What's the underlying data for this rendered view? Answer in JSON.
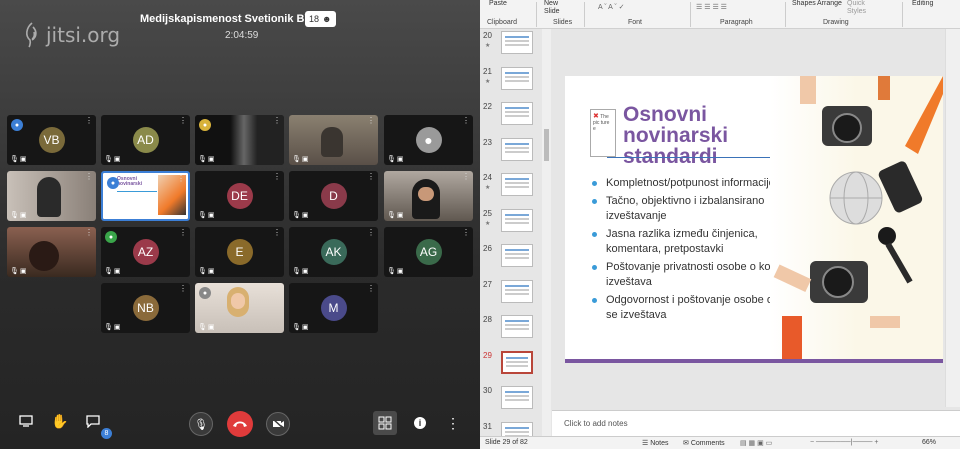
{
  "jitsi": {
    "logo_text": "jitsi.org",
    "meeting_title": "Medijskapismenost Svetionik BYS",
    "participant_count": "18",
    "timer": "2:04:59",
    "tiles": [
      {
        "initials": "VB",
        "color": "#7a6a3a",
        "status": "#3c7fd6"
      },
      {
        "initials": "AD",
        "color": "#8a8a4a"
      },
      {
        "initials": "",
        "color": "",
        "status": "#d8b23a",
        "video": "dark-room"
      },
      {
        "initials": "",
        "color": "",
        "video": "room"
      },
      {
        "initials": "",
        "color": "#7a7a7a",
        "video": "default-avatar"
      },
      {
        "initials": "",
        "color": "",
        "video": "person"
      },
      {
        "initials": "",
        "color": "",
        "status": "#3c7fd6",
        "video": "shared-slide"
      },
      {
        "initials": "DE",
        "color": "#9b3a4a"
      },
      {
        "initials": "D",
        "color": "#8a3a4a"
      },
      {
        "initials": "",
        "color": "",
        "video": "person-glasses"
      },
      {
        "initials": "",
        "color": "",
        "video": "person-lowlight"
      },
      {
        "initials": "AZ",
        "color": "#9b3a4a",
        "status": "#3aa54a"
      },
      {
        "initials": "E",
        "color": "#8a6a2a"
      },
      {
        "initials": "AK",
        "color": "#3a6a5a"
      },
      {
        "initials": "AG",
        "color": "#3a6a4a"
      },
      {
        "initials": "NB",
        "color": "#8a6a3a"
      },
      {
        "initials": "",
        "color": "",
        "status": "#888888",
        "video": "person-blonde"
      },
      {
        "initials": "M",
        "color": "#4a4a8a"
      }
    ],
    "chat_unread": "8"
  },
  "ppt": {
    "ribbon": {
      "paste": "Paste",
      "new_slide": "New\nSlide",
      "clipboard": "Clipboard",
      "slides": "Slides",
      "font": "Font",
      "paragraph": "Paragraph",
      "shapes": "Shapes",
      "arrange": "Arrange",
      "quick_styles": "Quick\nStyles",
      "drawing": "Drawing",
      "editing": "Editing"
    },
    "thumbnails": [
      {
        "number": "20",
        "star": true
      },
      {
        "number": "21",
        "star": true
      },
      {
        "number": "22",
        "star": false
      },
      {
        "number": "23",
        "star": false
      },
      {
        "number": "24",
        "star": true
      },
      {
        "number": "25",
        "star": true
      },
      {
        "number": "26",
        "star": false
      },
      {
        "number": "27",
        "star": false
      },
      {
        "number": "28",
        "star": false
      },
      {
        "number": "29",
        "star": false,
        "current": true
      },
      {
        "number": "30",
        "star": false
      },
      {
        "number": "31",
        "star": false
      }
    ],
    "slide": {
      "title": "Osnovni novinarski standardi",
      "placeholder_text": "The pic ture e",
      "bullets": [
        "Kompletnost/potpunost informacije",
        "Tačno, objektivno i izbalansirano izveštavanje",
        "Jasna razlika između činjenica, komentara, pretpostavki",
        "Poštovanje privatnosti osobe o kojoj se izveštava",
        "Odgovornost i poštovanje osobe o kojoj se izveštava"
      ]
    },
    "notes_placeholder": "Click to add notes",
    "status": {
      "slide_indicator": "Slide 29 of 82",
      "notes": "Notes",
      "comments": "Comments",
      "zoom": "66%"
    }
  }
}
